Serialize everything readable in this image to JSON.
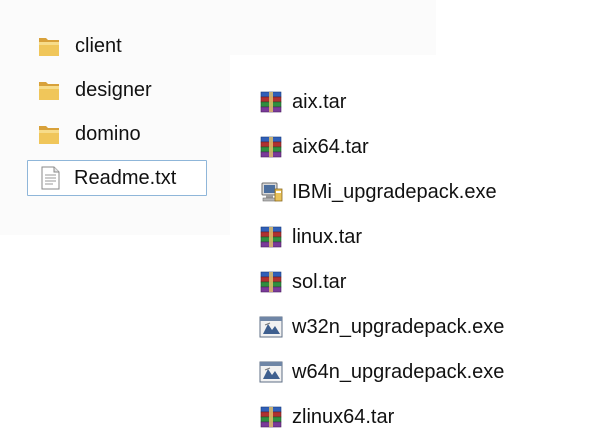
{
  "left_pane": {
    "items": [
      {
        "label": "client",
        "icon": "folder-icon",
        "type": "folder"
      },
      {
        "label": "designer",
        "icon": "folder-icon",
        "type": "folder"
      },
      {
        "label": "domino",
        "icon": "folder-icon",
        "type": "folder"
      },
      {
        "label": "Readme.txt",
        "icon": "text-file-icon",
        "type": "file",
        "selected": true
      }
    ]
  },
  "right_pane": {
    "items": [
      {
        "label": "aix.tar",
        "icon": "winrar-archive-icon"
      },
      {
        "label": "aix64.tar",
        "icon": "winrar-archive-icon"
      },
      {
        "label": "IBMi_upgradepack.exe",
        "icon": "installer-icon"
      },
      {
        "label": "linux.tar",
        "icon": "winrar-archive-icon"
      },
      {
        "label": "sol.tar",
        "icon": "winrar-archive-icon"
      },
      {
        "label": "w32n_upgradepack.exe",
        "icon": "setup-exe-icon"
      },
      {
        "label": "w64n_upgradepack.exe",
        "icon": "setup-exe-icon"
      },
      {
        "label": "zlinux64.tar",
        "icon": "winrar-archive-icon"
      }
    ]
  },
  "colors": {
    "folder": "#e7b94a",
    "selection_border": "#8fb6d9",
    "rar_blue": "#2f5fb8",
    "rar_red": "#b03030",
    "rar_green": "#2f8f3f",
    "rar_purple": "#7a3a99"
  }
}
